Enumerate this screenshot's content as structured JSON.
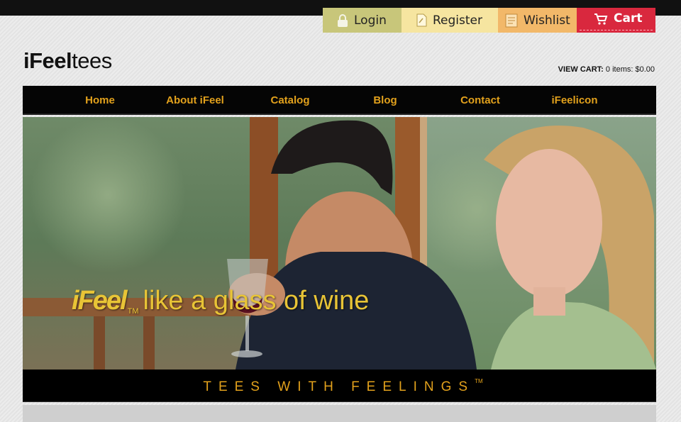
{
  "user_nav": {
    "login": "Login",
    "register": "Register",
    "wishlist": "Wishlist",
    "cart": "Cart"
  },
  "logo": {
    "bold": "iFeel",
    "light": "tees"
  },
  "view_cart": {
    "label": "VIEW CART:",
    "summary": "0 items: $0.00"
  },
  "main_nav": [
    {
      "label": "Home"
    },
    {
      "label": "About iFeel"
    },
    {
      "label": "Catalog"
    },
    {
      "label": "Blog"
    },
    {
      "label": "Contact"
    },
    {
      "label": "iFeelicon"
    }
  ],
  "hero": {
    "brand": "iFeel",
    "tm": "TM",
    "text": "like a glass of wine"
  },
  "strip": {
    "text": "TEES WITH FEELINGS",
    "tm": "TM"
  },
  "colors": {
    "nav_text": "#e2a11c",
    "login_tab": "#c8c67a",
    "register_tab": "#f6e5a0",
    "wishlist_tab": "#f2b869",
    "cart_tab": "#d9283e",
    "tagline": "#e8c436"
  }
}
